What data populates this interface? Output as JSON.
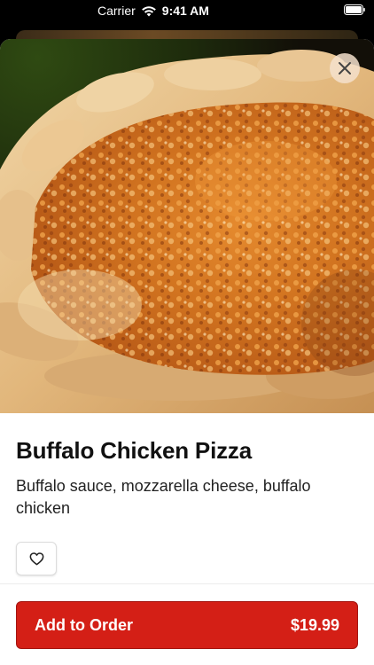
{
  "status_bar": {
    "carrier": "Carrier",
    "time": "9:41 AM",
    "wifi_icon": "wifi-icon",
    "battery_icon": "battery-icon"
  },
  "item": {
    "name": "Buffalo Chicken Pizza",
    "description": "Buffalo sauce, mozzarella cheese, buffalo chicken",
    "image_icon": "pizza-photo"
  },
  "actions": {
    "close_icon": "close-icon",
    "favorite_icon": "heart-icon",
    "add_label": "Add to Order",
    "price": "$19.99"
  },
  "colors": {
    "primary": "#d41f16",
    "text": "#111111"
  }
}
